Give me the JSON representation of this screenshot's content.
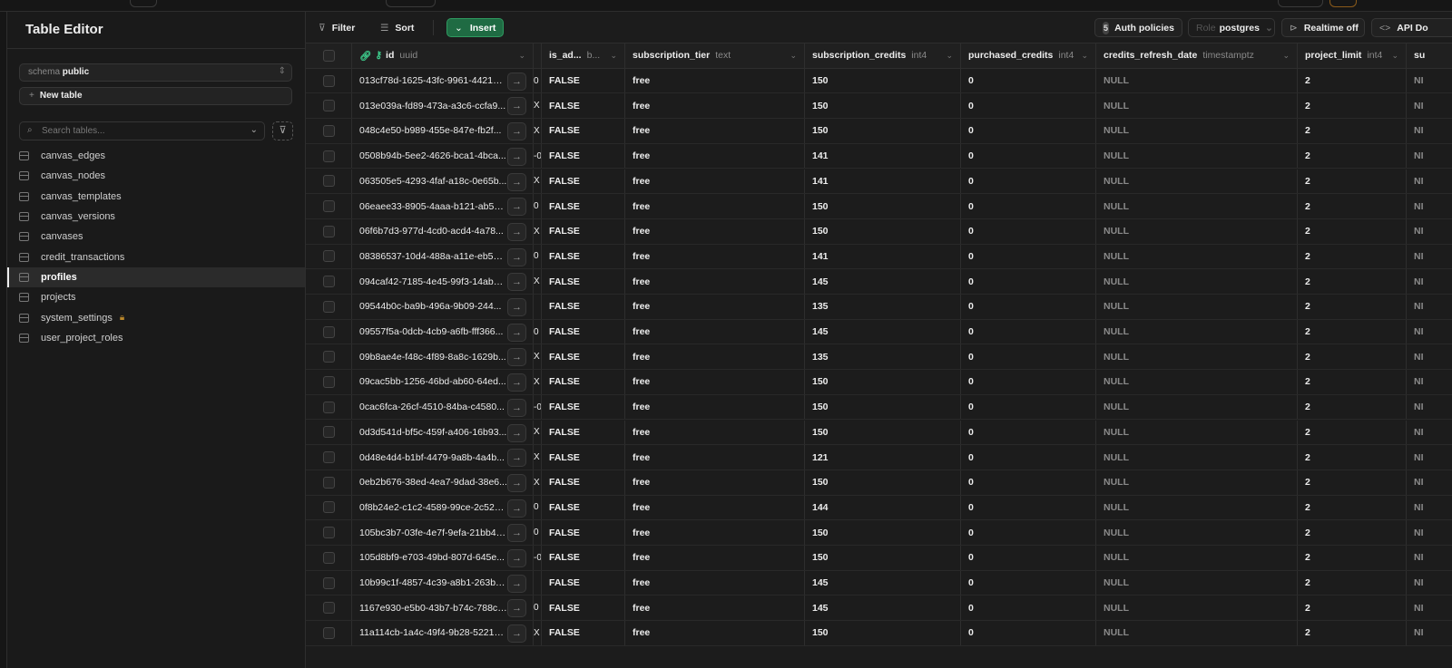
{
  "sidebar": {
    "title": "Table Editor",
    "schema_label": "schema",
    "schema_value": "public",
    "new_table": "New table",
    "search_placeholder": "Search tables...",
    "tables": [
      {
        "name": "canvas_edges"
      },
      {
        "name": "canvas_nodes"
      },
      {
        "name": "canvas_templates"
      },
      {
        "name": "canvas_versions"
      },
      {
        "name": "canvases"
      },
      {
        "name": "credit_transactions"
      },
      {
        "name": "profiles",
        "active": true
      },
      {
        "name": "projects"
      },
      {
        "name": "system_settings",
        "locked": true
      },
      {
        "name": "user_project_roles"
      }
    ]
  },
  "toolbar": {
    "filter": "Filter",
    "sort": "Sort",
    "insert": "Insert",
    "auth_count": "5",
    "auth_policies": "Auth policies",
    "role_label": "Role",
    "role_value": "postgres",
    "realtime": "Realtime off",
    "api_docs": "API Do"
  },
  "columns": [
    {
      "name": "id",
      "type": "uuid"
    },
    {
      "name": "is_ad...",
      "type": "b..."
    },
    {
      "name": "subscription_tier",
      "type": "text"
    },
    {
      "name": "subscription_credits",
      "type": "int4"
    },
    {
      "name": "purchased_credits",
      "type": "int4"
    },
    {
      "name": "credits_refresh_date",
      "type": "timestamptz"
    },
    {
      "name": "project_limit",
      "type": "int4"
    },
    {
      "name": "su",
      "type": ""
    }
  ],
  "rows": [
    {
      "id": "013cf78d-1625-43fc-9961-442189...",
      "x": "0",
      "is_admin": "FALSE",
      "tier": "free",
      "credits": "150",
      "purchased": "0",
      "refresh": "NULL",
      "limit": "2",
      "su": "NI"
    },
    {
      "id": "013e039a-fd89-473a-a3c6-ccfa9...",
      "x": "X",
      "is_admin": "FALSE",
      "tier": "free",
      "credits": "150",
      "purchased": "0",
      "refresh": "NULL",
      "limit": "2",
      "su": "NI"
    },
    {
      "id": "048c4e50-b989-455e-847e-fb2f...",
      "x": "X",
      "is_admin": "FALSE",
      "tier": "free",
      "credits": "150",
      "purchased": "0",
      "refresh": "NULL",
      "limit": "2",
      "su": "NI"
    },
    {
      "id": "0508b94b-5ee2-4626-bca1-4bca...",
      "x": "-0",
      "is_admin": "FALSE",
      "tier": "free",
      "credits": "141",
      "purchased": "0",
      "refresh": "NULL",
      "limit": "2",
      "su": "NI"
    },
    {
      "id": "063505e5-4293-4faf-a18c-0e65b...",
      "x": "X",
      "is_admin": "FALSE",
      "tier": "free",
      "credits": "141",
      "purchased": "0",
      "refresh": "NULL",
      "limit": "2",
      "su": "NI"
    },
    {
      "id": "06eaee33-8905-4aaa-b121-ab552...",
      "x": "0",
      "is_admin": "FALSE",
      "tier": "free",
      "credits": "150",
      "purchased": "0",
      "refresh": "NULL",
      "limit": "2",
      "su": "NI"
    },
    {
      "id": "06f6b7d3-977d-4cd0-acd4-4a78...",
      "x": "X",
      "is_admin": "FALSE",
      "tier": "free",
      "credits": "150",
      "purchased": "0",
      "refresh": "NULL",
      "limit": "2",
      "su": "NI"
    },
    {
      "id": "08386537-10d4-488a-a11e-eb5a6...",
      "x": "0",
      "is_admin": "FALSE",
      "tier": "free",
      "credits": "141",
      "purchased": "0",
      "refresh": "NULL",
      "limit": "2",
      "su": "NI"
    },
    {
      "id": "094caf42-7185-4e45-99f3-14abee...",
      "x": "X",
      "is_admin": "FALSE",
      "tier": "free",
      "credits": "145",
      "purchased": "0",
      "refresh": "NULL",
      "limit": "2",
      "su": "NI"
    },
    {
      "id": "09544b0c-ba9b-496a-9b09-244...",
      "x": "",
      "is_admin": "FALSE",
      "tier": "free",
      "credits": "135",
      "purchased": "0",
      "refresh": "NULL",
      "limit": "2",
      "su": "NI"
    },
    {
      "id": "09557f5a-0dcb-4cb9-a6fb-fff366...",
      "x": "0",
      "is_admin": "FALSE",
      "tier": "free",
      "credits": "145",
      "purchased": "0",
      "refresh": "NULL",
      "limit": "2",
      "su": "NI"
    },
    {
      "id": "09b8ae4e-f48c-4f89-8a8c-1629b...",
      "x": "X",
      "is_admin": "FALSE",
      "tier": "free",
      "credits": "135",
      "purchased": "0",
      "refresh": "NULL",
      "limit": "2",
      "su": "NI"
    },
    {
      "id": "09cac5bb-1256-46bd-ab60-64ed...",
      "x": "X",
      "is_admin": "FALSE",
      "tier": "free",
      "credits": "150",
      "purchased": "0",
      "refresh": "NULL",
      "limit": "2",
      "su": "NI"
    },
    {
      "id": "0cac6fca-26cf-4510-84ba-c4580...",
      "x": "-0",
      "is_admin": "FALSE",
      "tier": "free",
      "credits": "150",
      "purchased": "0",
      "refresh": "NULL",
      "limit": "2",
      "su": "NI"
    },
    {
      "id": "0d3d541d-bf5c-459f-a406-16b93...",
      "x": "X",
      "is_admin": "FALSE",
      "tier": "free",
      "credits": "150",
      "purchased": "0",
      "refresh": "NULL",
      "limit": "2",
      "su": "NI"
    },
    {
      "id": "0d48e4d4-b1bf-4479-9a8b-4a4b...",
      "x": "X",
      "is_admin": "FALSE",
      "tier": "free",
      "credits": "121",
      "purchased": "0",
      "refresh": "NULL",
      "limit": "2",
      "su": "NI"
    },
    {
      "id": "0eb2b676-38ed-4ea7-9dad-38e6...",
      "x": "X",
      "is_admin": "FALSE",
      "tier": "free",
      "credits": "150",
      "purchased": "0",
      "refresh": "NULL",
      "limit": "2",
      "su": "NI"
    },
    {
      "id": "0f8b24e2-c1c2-4589-99ce-2c52d...",
      "x": "0",
      "is_admin": "FALSE",
      "tier": "free",
      "credits": "144",
      "purchased": "0",
      "refresh": "NULL",
      "limit": "2",
      "su": "NI"
    },
    {
      "id": "105bc3b7-03fe-4e7f-9efa-21bb40...",
      "x": "0",
      "is_admin": "FALSE",
      "tier": "free",
      "credits": "150",
      "purchased": "0",
      "refresh": "NULL",
      "limit": "2",
      "su": "NI"
    },
    {
      "id": "105d8bf9-e703-49bd-807d-645e...",
      "x": "-0",
      "is_admin": "FALSE",
      "tier": "free",
      "credits": "150",
      "purchased": "0",
      "refresh": "NULL",
      "limit": "2",
      "su": "NI"
    },
    {
      "id": "10b99c1f-4857-4c39-a8b1-263b8...",
      "x": "",
      "is_admin": "FALSE",
      "tier": "free",
      "credits": "145",
      "purchased": "0",
      "refresh": "NULL",
      "limit": "2",
      "su": "NI"
    },
    {
      "id": "1167e930-e5b0-43b7-b74c-788c9...",
      "x": "0",
      "is_admin": "FALSE",
      "tier": "free",
      "credits": "145",
      "purchased": "0",
      "refresh": "NULL",
      "limit": "2",
      "su": "NI"
    },
    {
      "id": "11a114cb-1a4c-49f4-9b28-52219ec...",
      "x": "X",
      "is_admin": "FALSE",
      "tier": "free",
      "credits": "150",
      "purchased": "0",
      "refresh": "NULL",
      "limit": "2",
      "su": "NI"
    }
  ]
}
